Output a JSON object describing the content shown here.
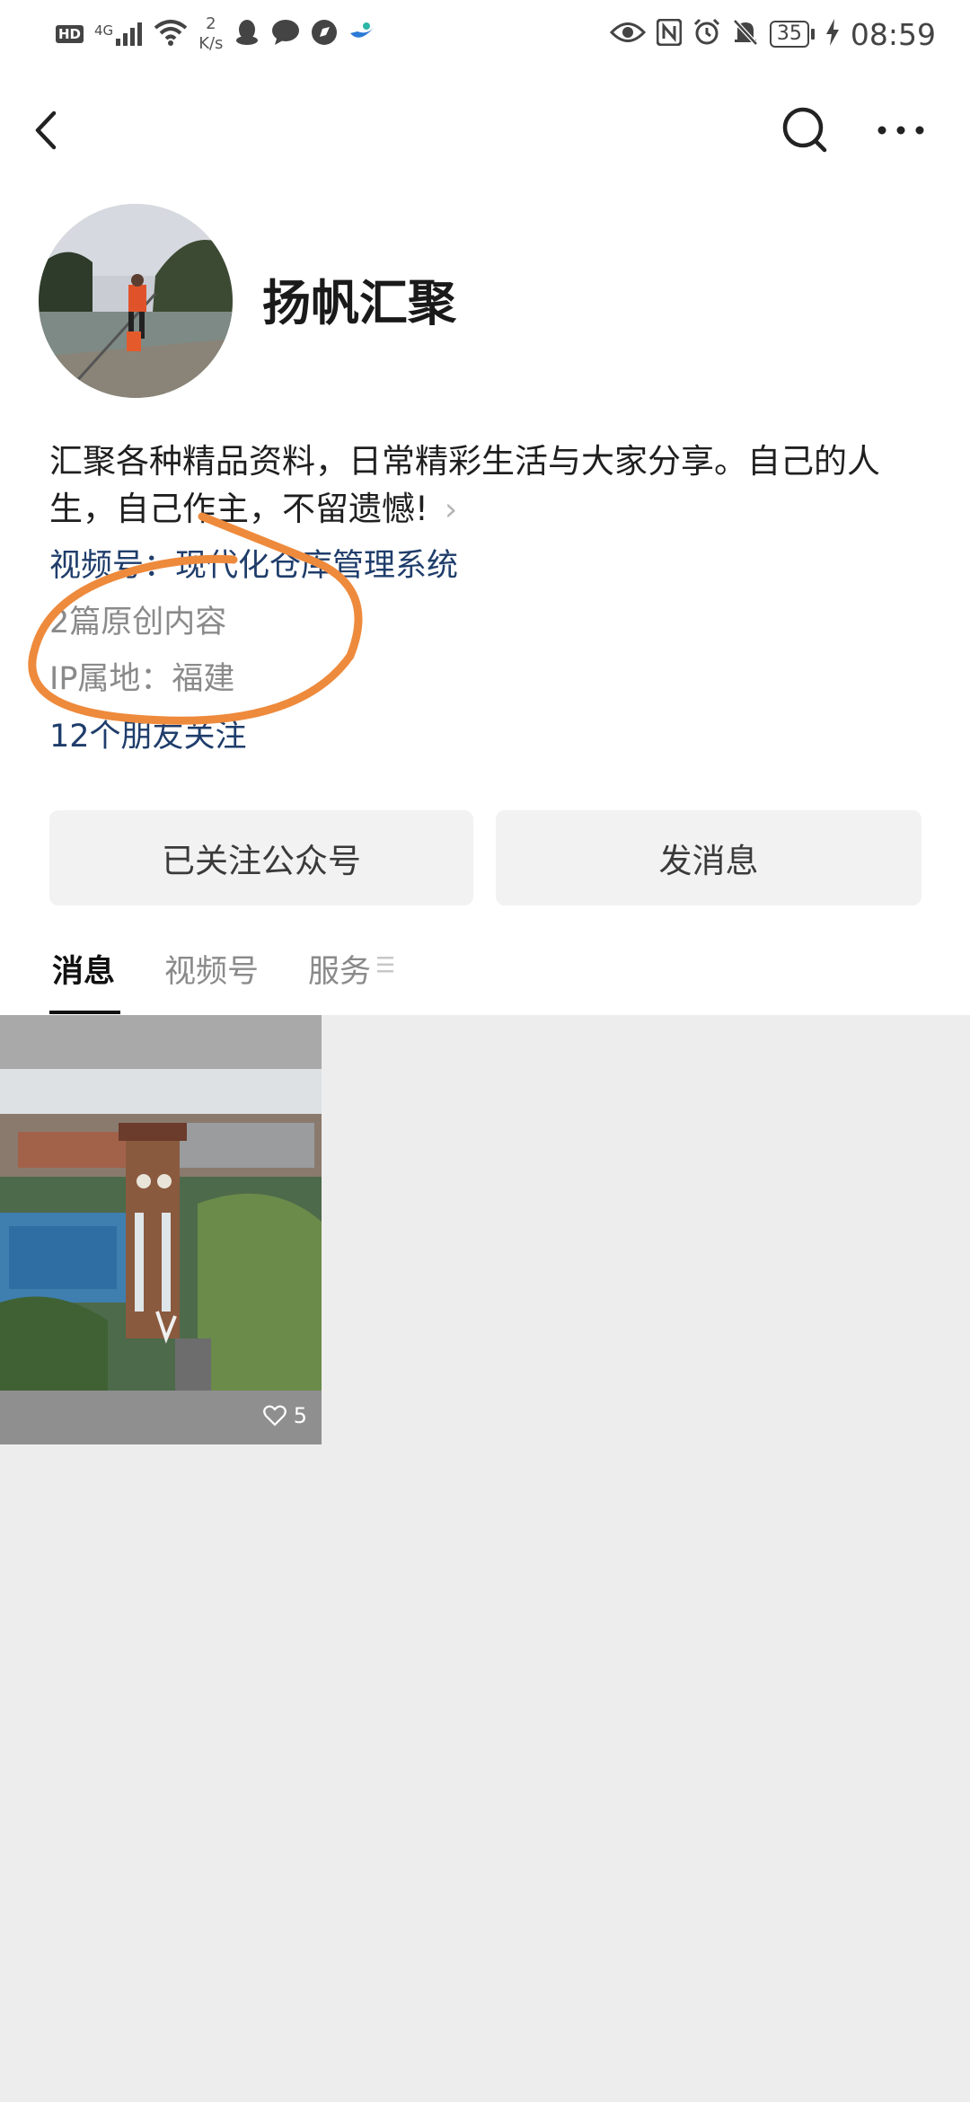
{
  "status_bar": {
    "hd": "HD",
    "network": "4G",
    "speed_value": "2",
    "speed_unit": "K/s",
    "battery": "35",
    "time": "08:59"
  },
  "nav": {
    "back_icon": "chevron-left-icon",
    "search_icon": "search-icon",
    "more_icon": "more-icon"
  },
  "profile": {
    "name": "扬帆汇聚",
    "intro": "汇聚各种精品资料，日常精彩生活与大家分享。自己的人生，自己作主，不留遗憾!",
    "channels": "视频号：现代化仓库管理系统",
    "original_articles": "2篇原创内容",
    "ip_location": "IP属地：福建",
    "friends_following": "12个朋友关注"
  },
  "actions": {
    "follow_label": "已关注公众号",
    "message_label": "发消息"
  },
  "tabs": [
    {
      "label": "消息",
      "active": true
    },
    {
      "label": "视频号",
      "active": false
    },
    {
      "label": "服务",
      "active": false
    }
  ],
  "feed": {
    "posts": [
      {
        "likes": "5"
      }
    ]
  },
  "colors": {
    "link_blue": "#1f3d6b",
    "annotation_orange": "#ee8a3c",
    "feed_bg": "#ededed"
  }
}
